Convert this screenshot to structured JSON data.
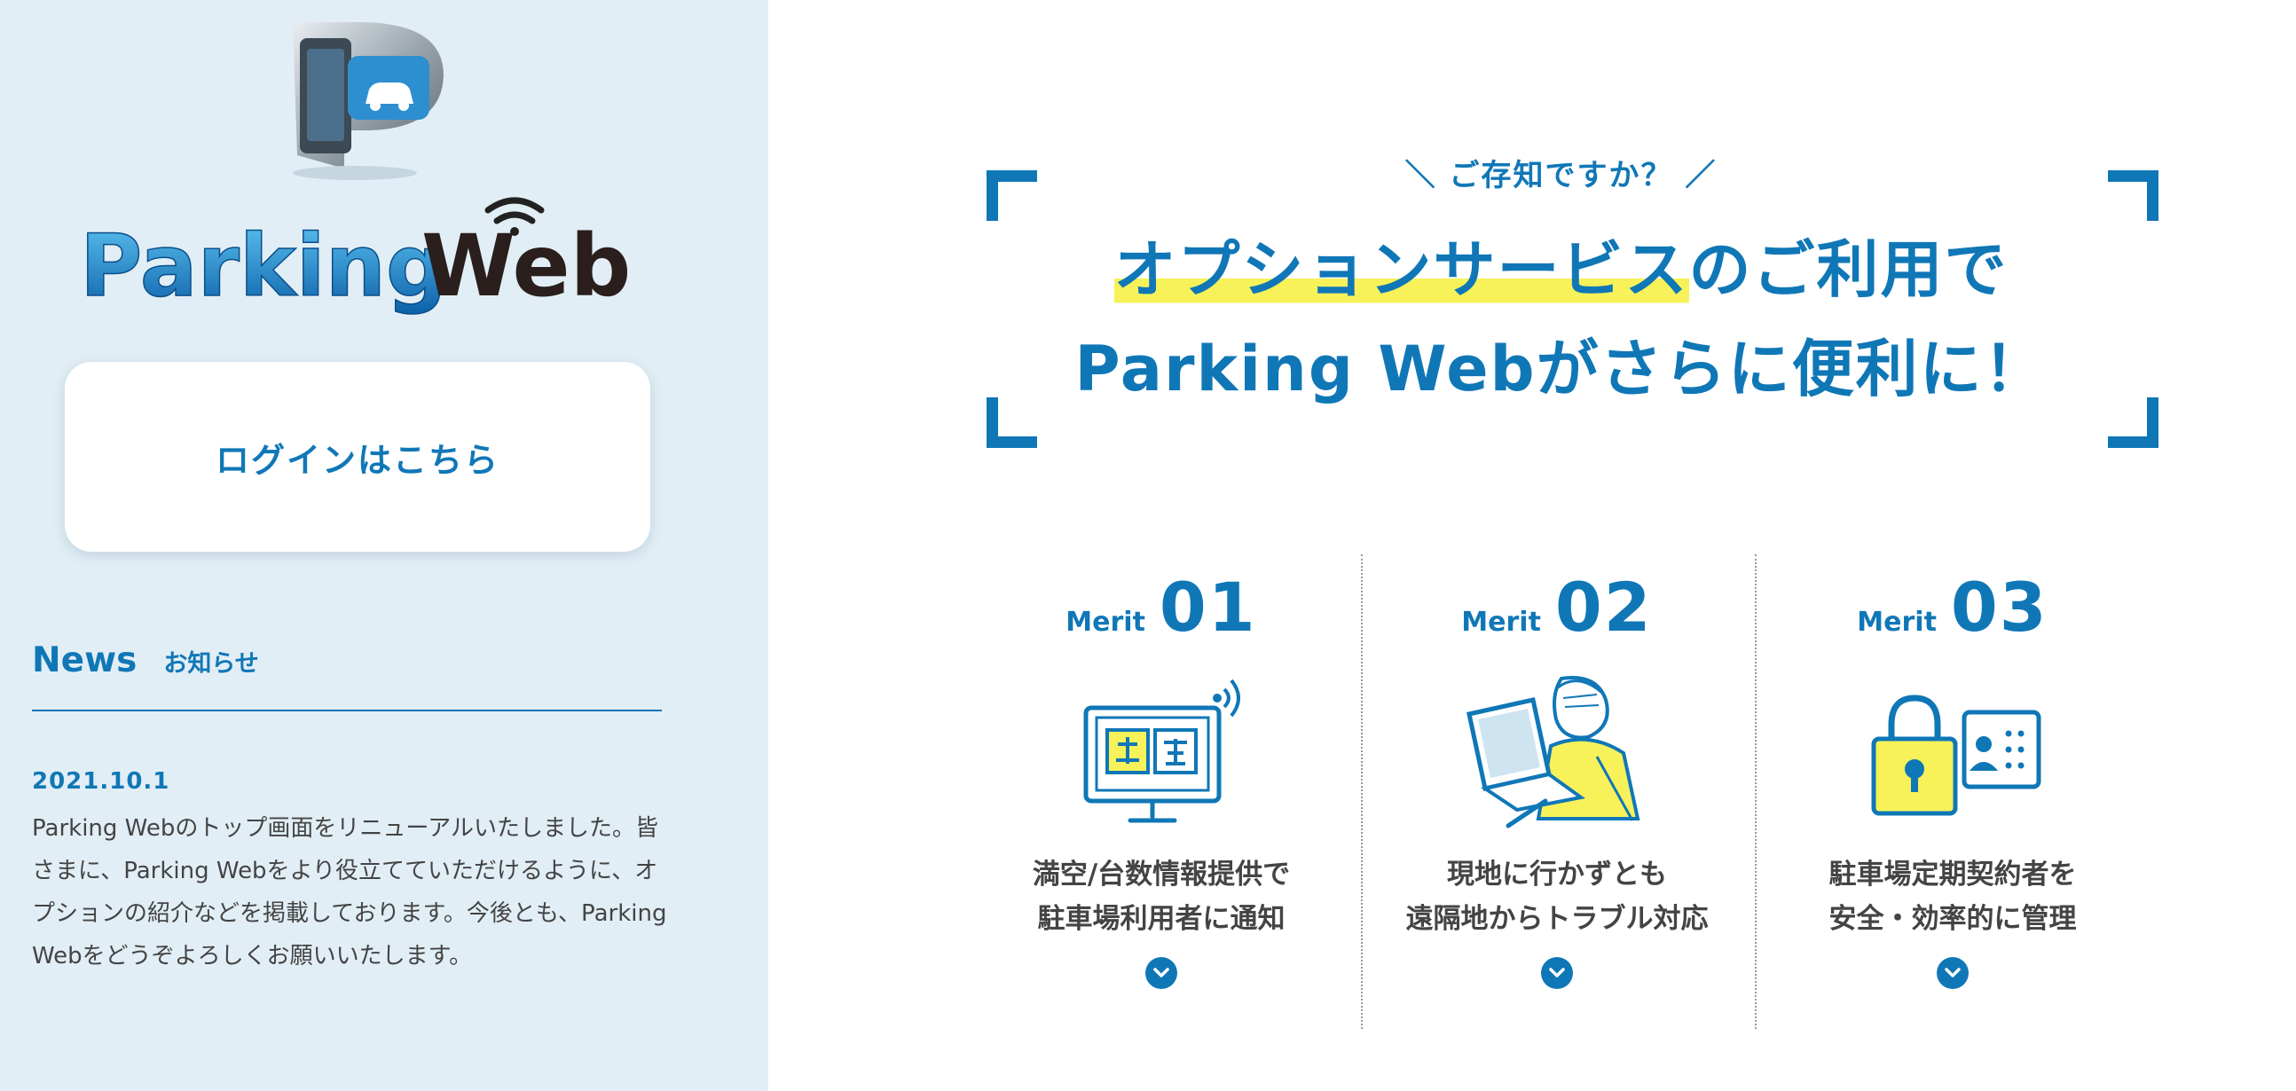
{
  "sidebar": {
    "logo_text": "Parking Web",
    "login_label": "ログインはこちら",
    "news": {
      "title": "News",
      "subtitle": "お知らせ",
      "items": [
        {
          "date": "2021.10.1",
          "text": "Parking Webのトップ画面をリニューアルいたしました。皆さまに、Parking Webをより役立てていただけるように、オプションの紹介などを掲載しております。今後とも、Parking Webをどうぞよろしくお願いいたします。"
        }
      ]
    }
  },
  "main": {
    "kicker": "＼ ご存知ですか？ ／",
    "headline_highlight": "オプションサービス",
    "headline_line1_rest": "のご利用で",
    "headline_line2": "Parking Webがさらに便利に！",
    "merits": [
      {
        "label": "Merit",
        "number": "01",
        "line1": "満空/台数情報提供で",
        "line2": "駐車場利用者に通知",
        "icon": "monitor-vacancy-icon"
      },
      {
        "label": "Merit",
        "number": "02",
        "line1": "現地に行かずとも",
        "line2": "遠隔地からトラブル対応",
        "icon": "laptop-user-icon"
      },
      {
        "label": "Merit",
        "number": "03",
        "line1": "駐車場定期契約者を",
        "line2": "安全・効率的に管理",
        "icon": "lock-idcard-icon"
      }
    ]
  },
  "colors": {
    "brand_blue": "#1077b7",
    "sidebar_bg": "#e2eef5",
    "highlight_yellow": "#f7f25a"
  }
}
